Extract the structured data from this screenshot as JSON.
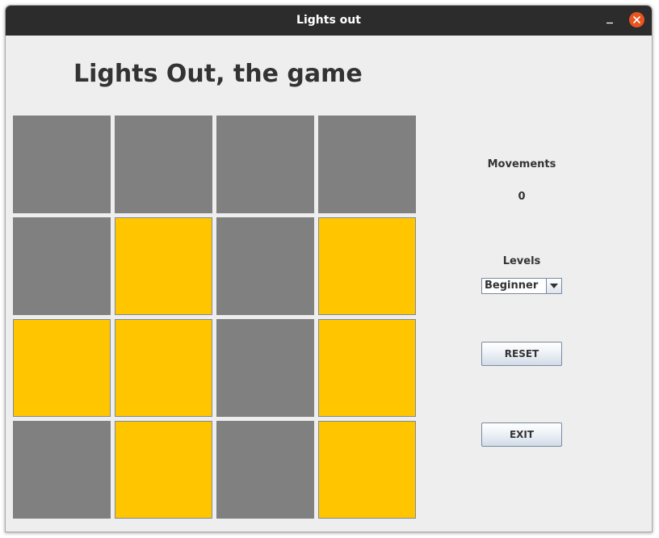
{
  "window": {
    "title": "Lights out"
  },
  "game": {
    "heading": "Lights Out, the game",
    "board": {
      "rows": 4,
      "cols": 4,
      "cells": [
        [
          0,
          0,
          0,
          0
        ],
        [
          0,
          1,
          0,
          1
        ],
        [
          1,
          1,
          0,
          1
        ],
        [
          0,
          1,
          0,
          1
        ]
      ],
      "on_color": "#ffc600",
      "off_color": "#808080"
    }
  },
  "sidebar": {
    "movements_label": "Movements",
    "movements_value": "0",
    "levels_label": "Levels",
    "levels_selected": "Beginner",
    "reset_label": "RESET",
    "exit_label": "EXIT"
  },
  "colors": {
    "titlebar": "#2c2c2c",
    "close_button": "#e95420",
    "window_background": "#eeeeee"
  }
}
